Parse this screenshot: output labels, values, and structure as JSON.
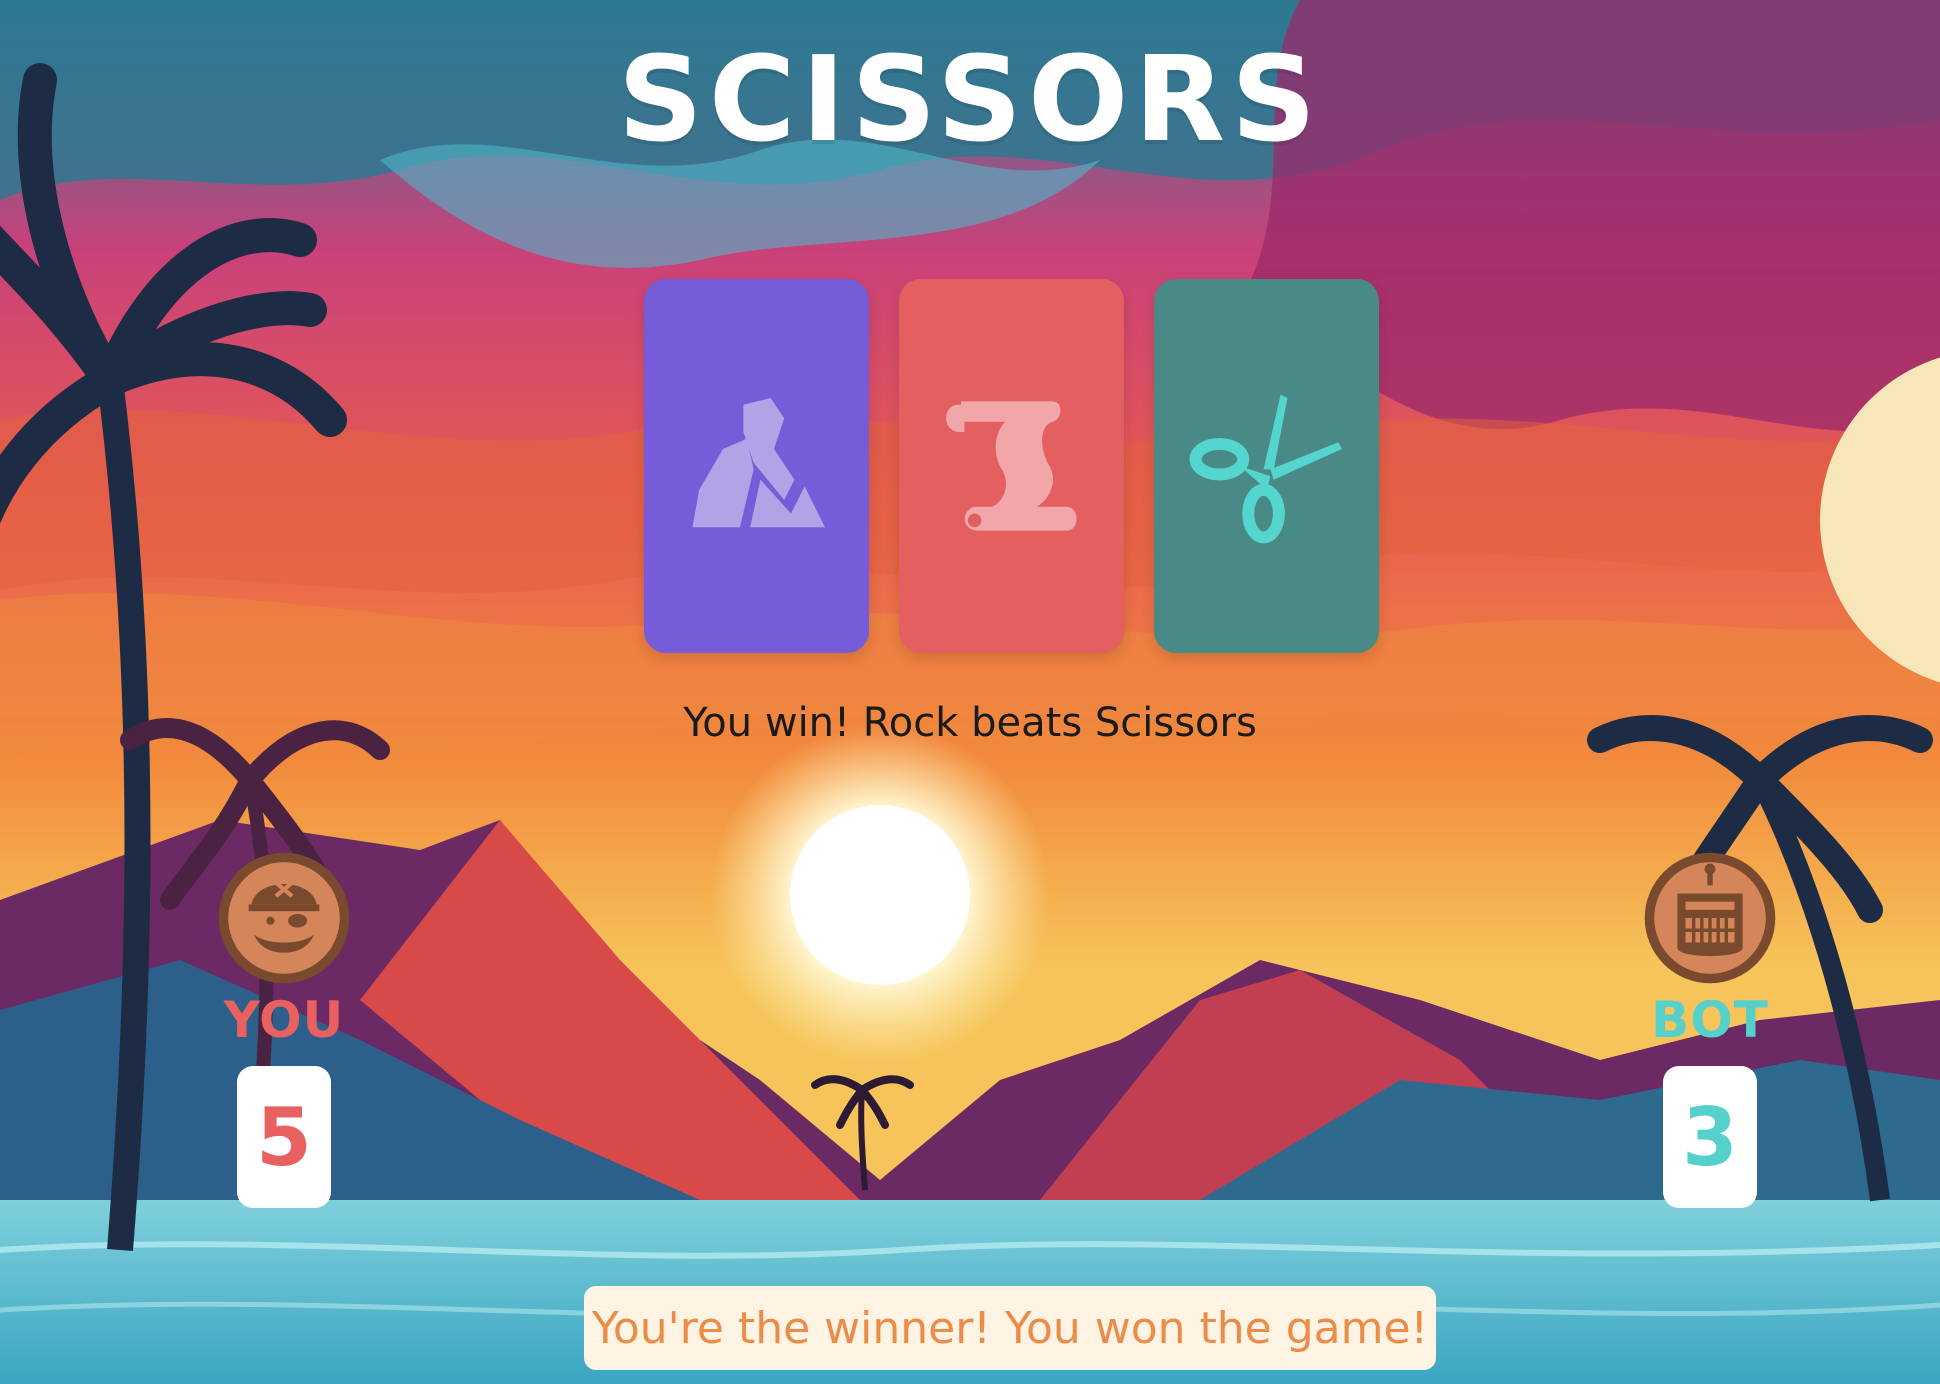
{
  "game": {
    "title": "SCISSORS",
    "round_message": "You win! Rock beats Scissors",
    "final_message": "You're the winner! You won the game!"
  },
  "choices": [
    {
      "name": "rock",
      "icon": "rock-icon",
      "card_color": "#775cd9",
      "icon_color": "#b3a3e6"
    },
    {
      "name": "paper",
      "icon": "scroll-icon",
      "card_color": "#e35f60",
      "icon_color": "#f1a6a9"
    },
    {
      "name": "scissors",
      "icon": "scissors-icon",
      "card_color": "#4a8a86",
      "icon_color": "#54d6cf"
    }
  ],
  "player": {
    "label": "YOU",
    "score": "5",
    "color": "#e8605f",
    "avatar": "pirate-avatar-icon"
  },
  "bot": {
    "label": "BOT",
    "score": "3",
    "color": "#55d0cb",
    "avatar": "robot-avatar-icon"
  },
  "colors": {
    "final_text": "#ec8c49",
    "final_bg": "#fff3e3",
    "avatar_ring": "#7a4a2e",
    "avatar_fill": "#d4865a"
  }
}
